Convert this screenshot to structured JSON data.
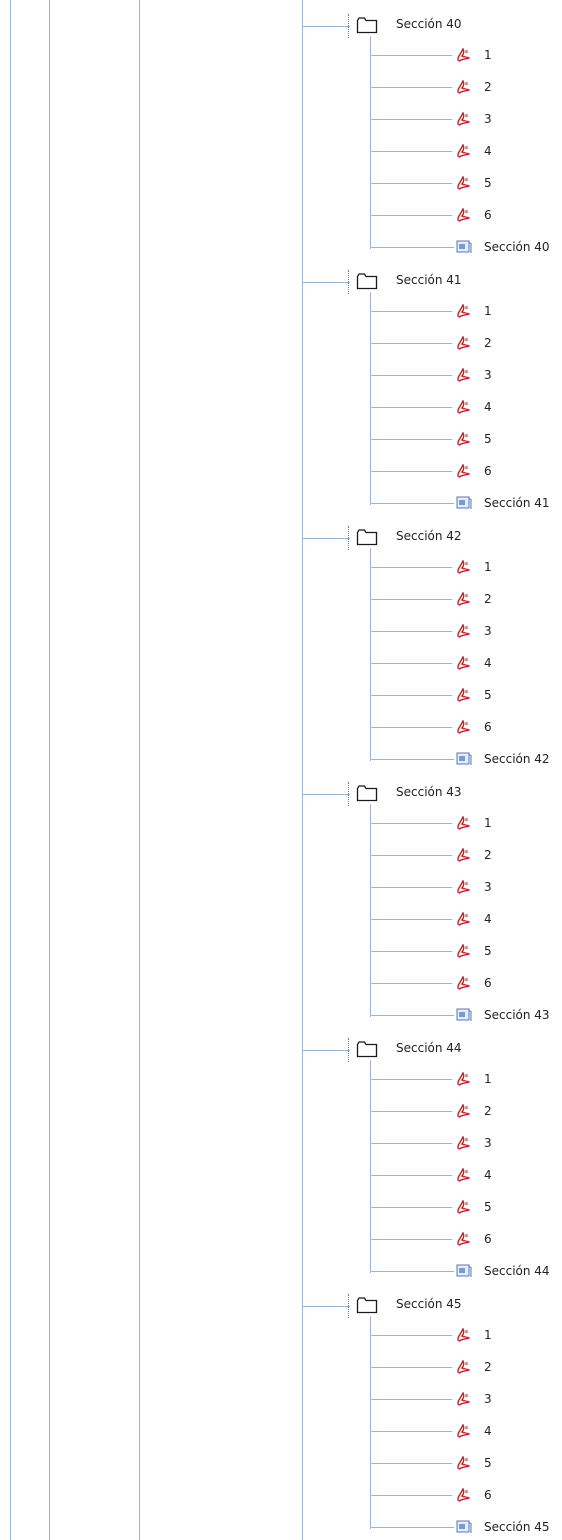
{
  "tree": {
    "sections": [
      {
        "label": "Sección 40",
        "items": [
          {
            "type": "pdf",
            "label": "1",
            "icon": "pdf-icon"
          },
          {
            "type": "pdf",
            "label": "2",
            "icon": "pdf-icon"
          },
          {
            "type": "pdf",
            "label": "3",
            "icon": "pdf-icon"
          },
          {
            "type": "pdf",
            "label": "4",
            "icon": "pdf-icon"
          },
          {
            "type": "pdf",
            "label": "5",
            "icon": "pdf-icon"
          },
          {
            "type": "pdf",
            "label": "6",
            "icon": "pdf-icon"
          },
          {
            "type": "doc",
            "label": "Sección 40",
            "icon": "document-icon"
          }
        ]
      },
      {
        "label": "Sección 41",
        "items": [
          {
            "type": "pdf",
            "label": "1",
            "icon": "pdf-icon"
          },
          {
            "type": "pdf",
            "label": "2",
            "icon": "pdf-icon"
          },
          {
            "type": "pdf",
            "label": "3",
            "icon": "pdf-icon"
          },
          {
            "type": "pdf",
            "label": "4",
            "icon": "pdf-icon"
          },
          {
            "type": "pdf",
            "label": "5",
            "icon": "pdf-icon"
          },
          {
            "type": "pdf",
            "label": "6",
            "icon": "pdf-icon"
          },
          {
            "type": "doc",
            "label": "Sección 41",
            "icon": "document-icon"
          }
        ]
      },
      {
        "label": "Sección 42",
        "items": [
          {
            "type": "pdf",
            "label": "1",
            "icon": "pdf-icon"
          },
          {
            "type": "pdf",
            "label": "2",
            "icon": "pdf-icon"
          },
          {
            "type": "pdf",
            "label": "3",
            "icon": "pdf-icon"
          },
          {
            "type": "pdf",
            "label": "4",
            "icon": "pdf-icon"
          },
          {
            "type": "pdf",
            "label": "5",
            "icon": "pdf-icon"
          },
          {
            "type": "pdf",
            "label": "6",
            "icon": "pdf-icon"
          },
          {
            "type": "doc",
            "label": "Sección 42",
            "icon": "document-icon"
          }
        ]
      },
      {
        "label": "Sección 43",
        "items": [
          {
            "type": "pdf",
            "label": "1",
            "icon": "pdf-icon"
          },
          {
            "type": "pdf",
            "label": "2",
            "icon": "pdf-icon"
          },
          {
            "type": "pdf",
            "label": "3",
            "icon": "pdf-icon"
          },
          {
            "type": "pdf",
            "label": "4",
            "icon": "pdf-icon"
          },
          {
            "type": "pdf",
            "label": "5",
            "icon": "pdf-icon"
          },
          {
            "type": "pdf",
            "label": "6",
            "icon": "pdf-icon"
          },
          {
            "type": "doc",
            "label": "Sección 43",
            "icon": "document-icon"
          }
        ]
      },
      {
        "label": "Sección 44",
        "items": [
          {
            "type": "pdf",
            "label": "1",
            "icon": "pdf-icon"
          },
          {
            "type": "pdf",
            "label": "2",
            "icon": "pdf-icon"
          },
          {
            "type": "pdf",
            "label": "3",
            "icon": "pdf-icon"
          },
          {
            "type": "pdf",
            "label": "4",
            "icon": "pdf-icon"
          },
          {
            "type": "pdf",
            "label": "5",
            "icon": "pdf-icon"
          },
          {
            "type": "pdf",
            "label": "6",
            "icon": "pdf-icon"
          },
          {
            "type": "doc",
            "label": "Sección 44",
            "icon": "document-icon"
          }
        ]
      },
      {
        "label": "Sección 45",
        "items": [
          {
            "type": "pdf",
            "label": "1",
            "icon": "pdf-icon"
          },
          {
            "type": "pdf",
            "label": "2",
            "icon": "pdf-icon"
          },
          {
            "type": "pdf",
            "label": "3",
            "icon": "pdf-icon"
          },
          {
            "type": "pdf",
            "label": "4",
            "icon": "pdf-icon"
          },
          {
            "type": "pdf",
            "label": "5",
            "icon": "pdf-icon"
          },
          {
            "type": "pdf",
            "label": "6",
            "icon": "pdf-icon"
          },
          {
            "type": "doc",
            "label": "Sección 45",
            "icon": "document-icon"
          }
        ]
      }
    ]
  },
  "colors": {
    "tree_line": "#9db2d6",
    "pdf_red": "#c8202a",
    "doc_blue": "#4a78c0",
    "folder_stroke": "#1a1a1a"
  }
}
